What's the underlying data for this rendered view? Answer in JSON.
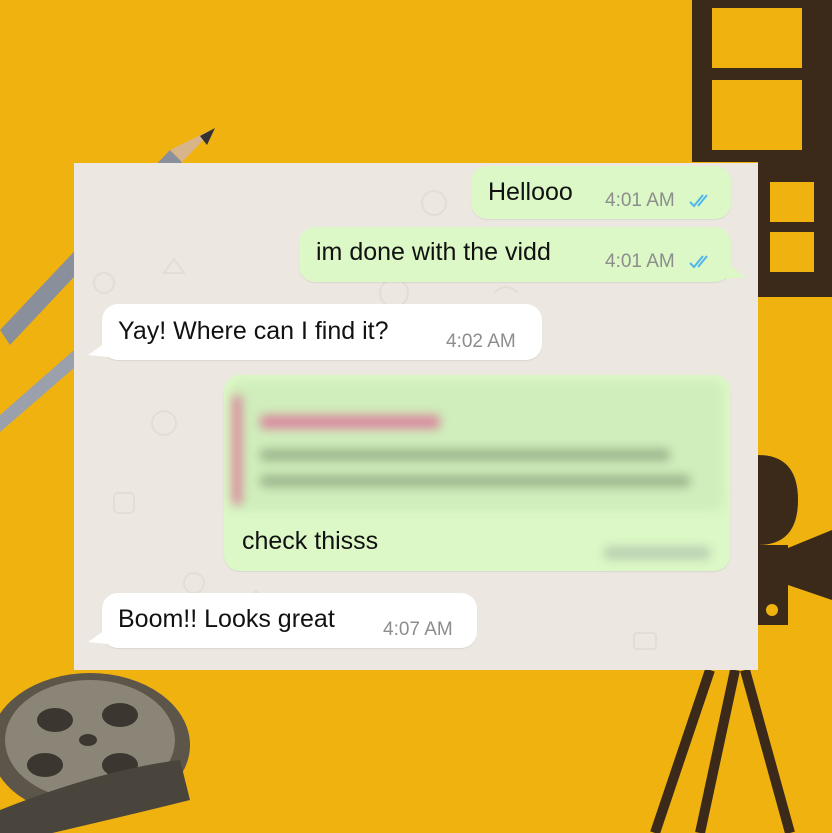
{
  "chat": {
    "messages": [
      {
        "text": "Hellooo",
        "time": "4:01 AM",
        "direction": "outgoing"
      },
      {
        "text": "im done with the vidd",
        "time": "4:01 AM",
        "direction": "outgoing"
      },
      {
        "text": "Yay! Where can I find it?",
        "time": "4:02 AM",
        "direction": "incoming"
      },
      {
        "text": "check thisss",
        "direction": "outgoing"
      },
      {
        "text": "Boom!! Looks great",
        "time": "4:07 AM",
        "direction": "incoming"
      }
    ]
  },
  "colors": {
    "background": "#f0b20e",
    "outgoing_bubble": "#dcf8c6",
    "incoming_bubble": "#ffffff",
    "read_ticks": "#4fb6ec",
    "quote_bar": "#d98a9e"
  },
  "icons": [
    "pencil-icon",
    "film-strip-icon",
    "movie-camera-icon",
    "film-reel-icon",
    "double-check-icon"
  ]
}
